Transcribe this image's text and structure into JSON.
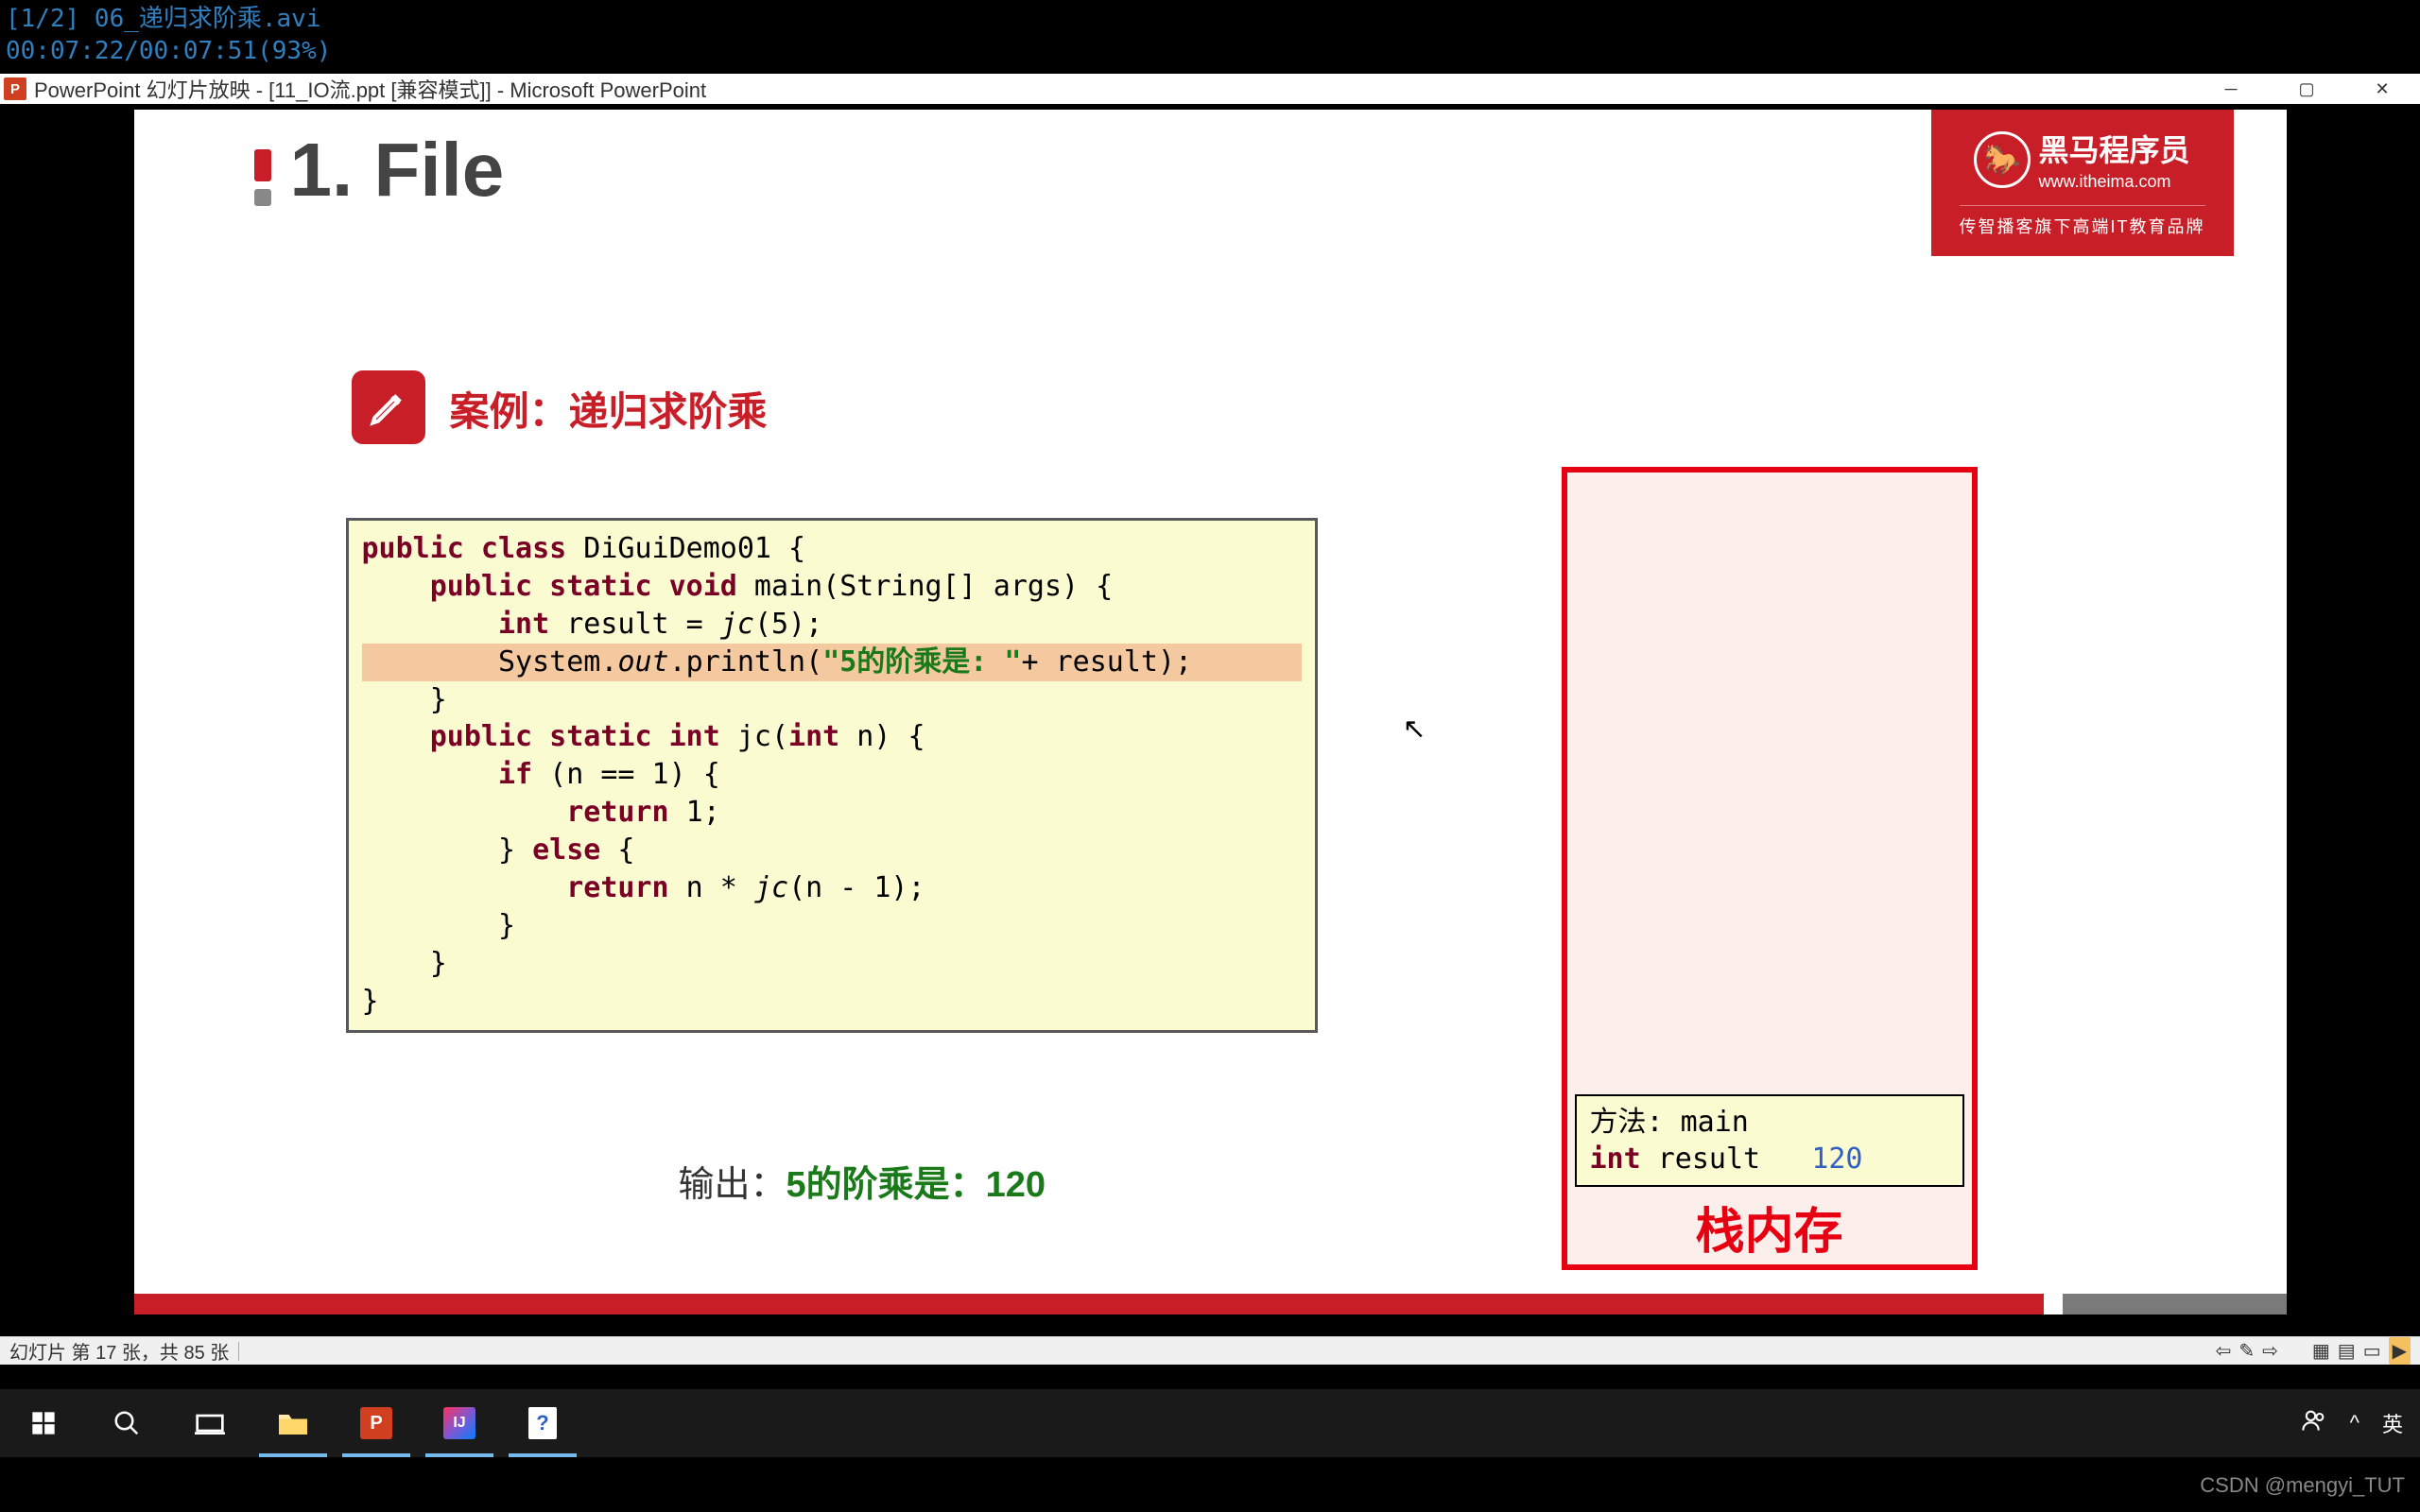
{
  "video": {
    "file_line": "[1/2] 06_递归求阶乘.avi",
    "time_line": "00:07:22/00:07:51(93%)"
  },
  "window": {
    "title": "PowerPoint 幻灯片放映 - [11_IO流.ppt [兼容模式]] - Microsoft PowerPoint",
    "icon_letter": "P"
  },
  "slide": {
    "title": "1. File",
    "logo": {
      "name": "黑马程序员",
      "url": "www.itheima.com",
      "tagline": "传智播客旗下高端IT教育品牌"
    },
    "case_title": "案例：递归求阶乘",
    "code": {
      "l1a": "public class",
      "l1b": " DiGuiDemo01 {",
      "l2a": "public static void",
      "l2b": " main(String[] args) {",
      "l3a": "int",
      "l3b": " result = ",
      "l3c": "jc",
      "l3d": "(5);",
      "l4a": "System.",
      "l4b": "out",
      "l4c": ".println(",
      "l4d": "\"5的阶乘是: \"",
      "l4e": "+ result);",
      "l5": "}",
      "l6a": "public static int",
      "l6b": " jc(",
      "l6c": "int",
      "l6d": " n) {",
      "l7a": "if",
      "l7b": " (n == 1) {",
      "l8a": "return",
      "l8b": " 1;",
      "l9a": "} ",
      "l9b": "else",
      "l9c": " {",
      "l10a": "return",
      "l10b": " n * ",
      "l10c": "jc",
      "l10d": "(n - 1);",
      "l11": "}",
      "l12": "}",
      "l13": "}"
    },
    "output": {
      "label": "输出：",
      "value": "5的阶乘是：120"
    },
    "stack": {
      "label": "栈内存",
      "frame": {
        "line1_label": "方法: ",
        "line1_val": "main",
        "line2_kw": "int",
        "line2_var": " result",
        "line2_val": "120"
      }
    }
  },
  "status": {
    "slide_counter": "幻灯片 第 17 张，共 85 张"
  },
  "taskbar": {
    "right_lang": "英",
    "people": "👥",
    "chev": "^"
  },
  "watermark": "CSDN @mengyi_TUT"
}
